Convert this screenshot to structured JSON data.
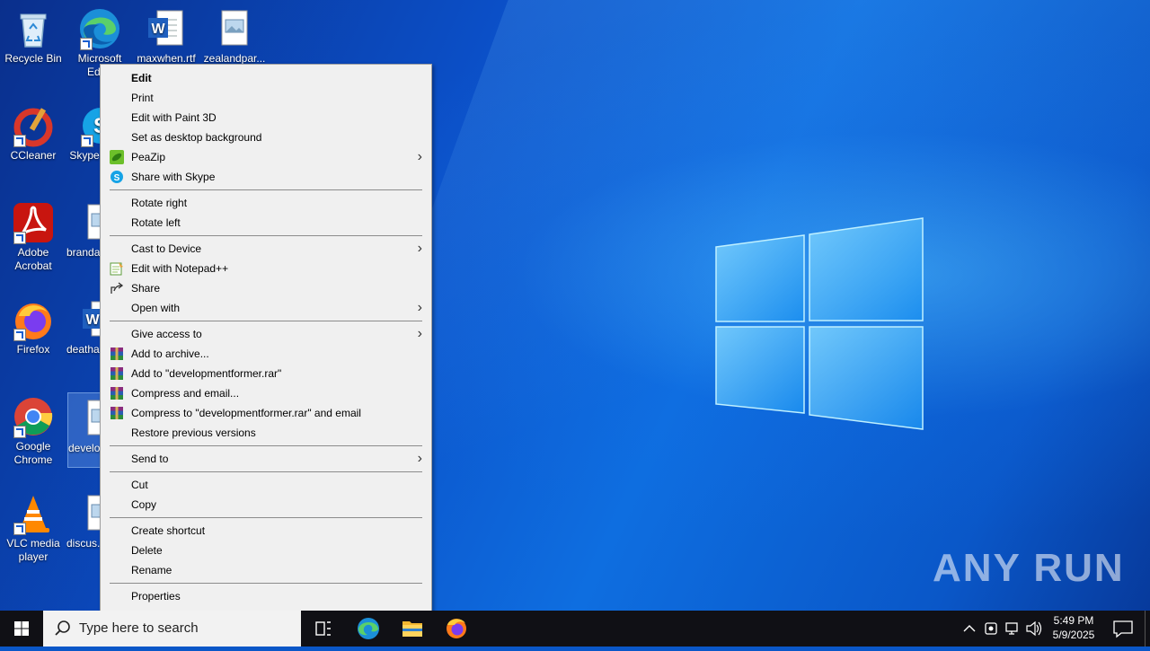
{
  "desktop": {
    "icons": [
      {
        "label": "Recycle Bin"
      },
      {
        "label": "Microsoft Edge"
      },
      {
        "label": "maxwhen.rtf"
      },
      {
        "label": "zealandpar..."
      },
      {
        "label": "CCleaner"
      },
      {
        "label": "Skype"
      },
      {
        "label": "Adobe Acrobat"
      },
      {
        "label": "branda..."
      },
      {
        "label": "Firefox"
      },
      {
        "label": "deatha..."
      },
      {
        "label": "Google Chrome"
      },
      {
        "label": "developmentformer"
      },
      {
        "label": "VLC media player"
      },
      {
        "label": "discus..."
      }
    ]
  },
  "context_menu": {
    "items": [
      {
        "label": "Edit"
      },
      {
        "label": "Print"
      },
      {
        "label": "Edit with Paint 3D"
      },
      {
        "label": "Set as desktop background"
      },
      {
        "label": "PeaZip"
      },
      {
        "label": "Share with Skype"
      },
      {
        "label": "Rotate right"
      },
      {
        "label": "Rotate left"
      },
      {
        "label": "Cast to Device"
      },
      {
        "label": "Edit with Notepad++"
      },
      {
        "label": "Share"
      },
      {
        "label": "Open with"
      },
      {
        "label": "Give access to"
      },
      {
        "label": "Add to archive..."
      },
      {
        "label": "Add to \"developmentformer.rar\""
      },
      {
        "label": "Compress and email..."
      },
      {
        "label": "Compress to \"developmentformer.rar\" and email"
      },
      {
        "label": "Restore previous versions"
      },
      {
        "label": "Send to"
      },
      {
        "label": "Cut"
      },
      {
        "label": "Copy"
      },
      {
        "label": "Create shortcut"
      },
      {
        "label": "Delete"
      },
      {
        "label": "Rename"
      },
      {
        "label": "Properties"
      }
    ]
  },
  "taskbar": {
    "search_placeholder": "Type here to search",
    "clock_time": "5:49 PM",
    "clock_date": "5/9/2025"
  },
  "watermark": "ANY RUN",
  "colors": {
    "taskbar": "#101015",
    "menu_bg": "#f0f0f0",
    "wallpaper": "#0a57c8"
  }
}
